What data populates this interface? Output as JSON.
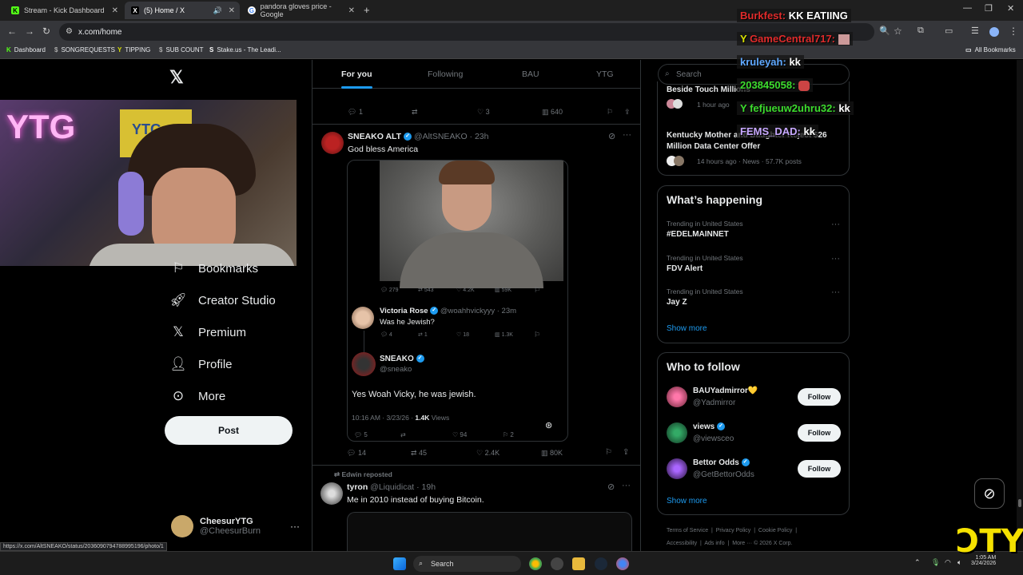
{
  "browser": {
    "tabs": [
      {
        "title": "Stream - Kick Dashboard",
        "icon": "kick-icon"
      },
      {
        "title": "(5) Home / X",
        "icon": "x-icon"
      },
      {
        "title": "pandora gloves price - Google",
        "icon": "google-icon"
      }
    ],
    "url": "x.com/home",
    "bookmarks": [
      "Dashboard",
      "SONGREQUESTS",
      "TIPPING",
      "SUB COUNT",
      "Stake.us - The Leadi...",
      "All Bookmarks"
    ]
  },
  "sidebar": {
    "nav": [
      {
        "label": "Bookmarks",
        "icon": "bookmark-icon"
      },
      {
        "label": "Creator Studio",
        "icon": "rocket-icon"
      },
      {
        "label": "Premium",
        "icon": "x-icon"
      },
      {
        "label": "Profile",
        "icon": "person-icon"
      },
      {
        "label": "More",
        "icon": "more-circle-icon"
      }
    ],
    "post_label": "Post",
    "account": {
      "name": "CheesurYTG",
      "handle": "@CheesurBurn"
    },
    "cam_text": "YTG",
    "flag_text": "YTG"
  },
  "status_url": "https://x.com/AltSNEAKO/status/2036090794788995196/photo/1",
  "feed": {
    "tabs": [
      "For you",
      "Following",
      "BAU",
      "YTG"
    ],
    "prev_actions": {
      "replies": "1",
      "reposts": "",
      "likes": "3",
      "views": "640"
    },
    "tweet": {
      "name": "SNEAKO ALT",
      "handle": "@AltSNEAKO",
      "time": "23h",
      "text": "God bless America",
      "media_actions": {
        "replies": "279",
        "reposts": "543",
        "likes": "4.2K",
        "views": "59K"
      },
      "reply1": {
        "name": "Victoria Rose",
        "handle": "@woahhvickyyy",
        "time": "23m",
        "text": "Was he Jewish?",
        "actions": {
          "replies": "4",
          "reposts": "1",
          "likes": "18",
          "views": "1.3K"
        }
      },
      "reply2": {
        "name": "SNEAKO",
        "handle": "@sneako",
        "text": "Yes Woah Vicky, he was jewish.",
        "meta": "10:16 AM · 3/23/26 ·",
        "views": "1.4K",
        "views_label": "Views",
        "actions": {
          "replies": "5",
          "reposts": "",
          "likes": "94",
          "bookmarks": "2"
        }
      },
      "actions": {
        "replies": "14",
        "reposts": "45",
        "likes": "2.4K",
        "views": "80K"
      }
    },
    "next": {
      "repost_by": "Edwin reposted",
      "name": "tyron",
      "handle": "@Liquidicat",
      "time": "19h",
      "text": "Me in 2010 instead of buying Bitcoin."
    }
  },
  "right": {
    "search_placeholder": "Search",
    "news": [
      {
        "title": "Beside Touch Millions",
        "meta": "1 hour ago"
      },
      {
        "title": "Kentucky Mother and Daughter Reject $26 Million Data Center Offer",
        "meta": "14 hours ago · News · 57.7K posts"
      }
    ],
    "happening_title": "What’s happening",
    "trends": [
      {
        "meta": "Trending in United States",
        "name": "#EDELMAINNET"
      },
      {
        "meta": "Trending in United States",
        "name": "FDV Alert"
      },
      {
        "meta": "Trending in United States",
        "name": "Jay Z"
      }
    ],
    "show_more": "Show more",
    "wtf_title": "Who to follow",
    "follow_label": "Follow",
    "wtf": [
      {
        "name": "BAUYadmirror💛",
        "handle": "@Yadmirror"
      },
      {
        "name": "views",
        "handle": "@viewsceo"
      },
      {
        "name": "Bettor Odds",
        "handle": "@GetBettorOdds"
      }
    ],
    "footer": [
      "Terms of Service",
      "Privacy Policy",
      "Cookie Policy",
      "Accessibility",
      "Ads info",
      "More ···",
      "© 2026 X Corp."
    ]
  },
  "chat": [
    {
      "user": "Burkfest:",
      "msg": "KK EATIING",
      "color": "#e02b2b"
    },
    {
      "user": "GameCentral717:",
      "msg": "",
      "color": "#e02b2b"
    },
    {
      "user": "kruleyah:",
      "msg": "kk",
      "color": "#5fa8ff"
    },
    {
      "user": "203845058:",
      "msg": "",
      "color": "#3ddc2e"
    },
    {
      "user": "fefjueuw2uhru32:",
      "msg": "kk",
      "color": "#3ddc2e"
    },
    {
      "user": "FEMS_DAD:",
      "msg": "kk",
      "color": "#c7a8ff"
    }
  ],
  "taskbar": {
    "search": "Search",
    "time": "1:05 AM",
    "date": "3/24/2026"
  },
  "brand": "ƆTY",
  "colors": {
    "accent": "#1d9bf0",
    "bg": "#000000",
    "text": "#e7e9ea",
    "muted": "#71767b"
  }
}
